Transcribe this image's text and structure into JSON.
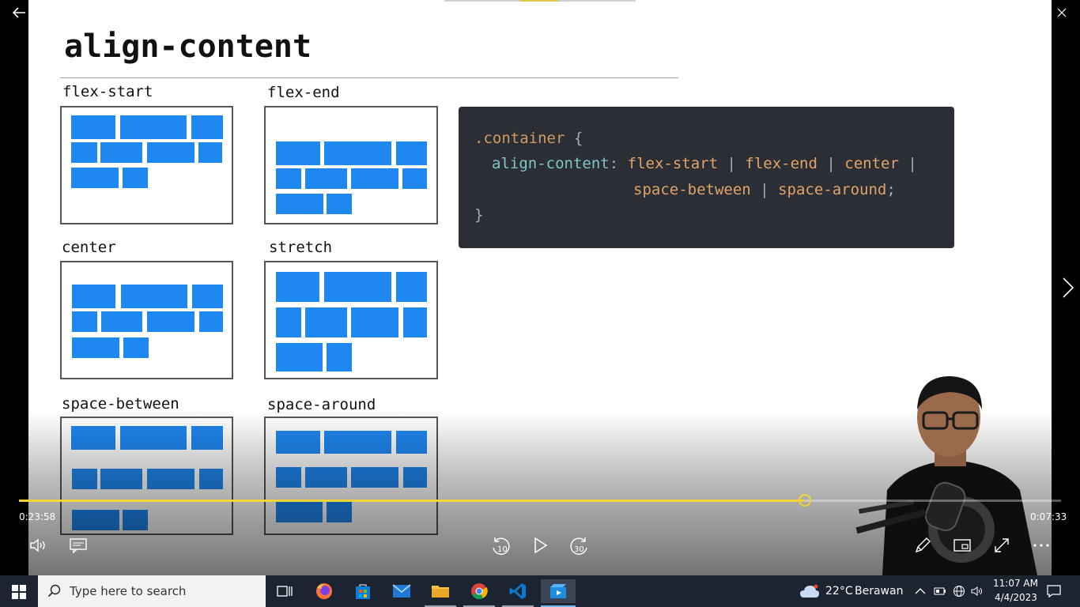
{
  "slide": {
    "title": "align-content",
    "demos": [
      {
        "label": "flex-start"
      },
      {
        "label": "flex-end"
      },
      {
        "label": "center"
      },
      {
        "label": "stretch"
      },
      {
        "label": "space-between"
      },
      {
        "label": "space-around"
      }
    ],
    "code": {
      "selector": ".container",
      "open_brace": "{",
      "property": "align-content",
      "colon": ":",
      "values": [
        "flex-start",
        "flex-end",
        "center",
        "space-between",
        "space-around"
      ],
      "separator": "|",
      "semicolon": ";",
      "close_brace": "}"
    }
  },
  "player": {
    "elapsed": "0:23:58",
    "remaining": "0:07:33",
    "progress": 0.754,
    "rewind_seconds": "10",
    "forward_seconds": "30"
  },
  "taskbar": {
    "search_placeholder": "Type here to search",
    "weather_temp": "22°C",
    "weather_desc": "Berawan",
    "time": "11:07 AM",
    "date": "4/4/2023"
  },
  "colors": {
    "accent": "#f2d338",
    "demo_block": "#1f87f0",
    "code_bg": "#2b2e34",
    "taskbar_bg": "#1c2431"
  }
}
